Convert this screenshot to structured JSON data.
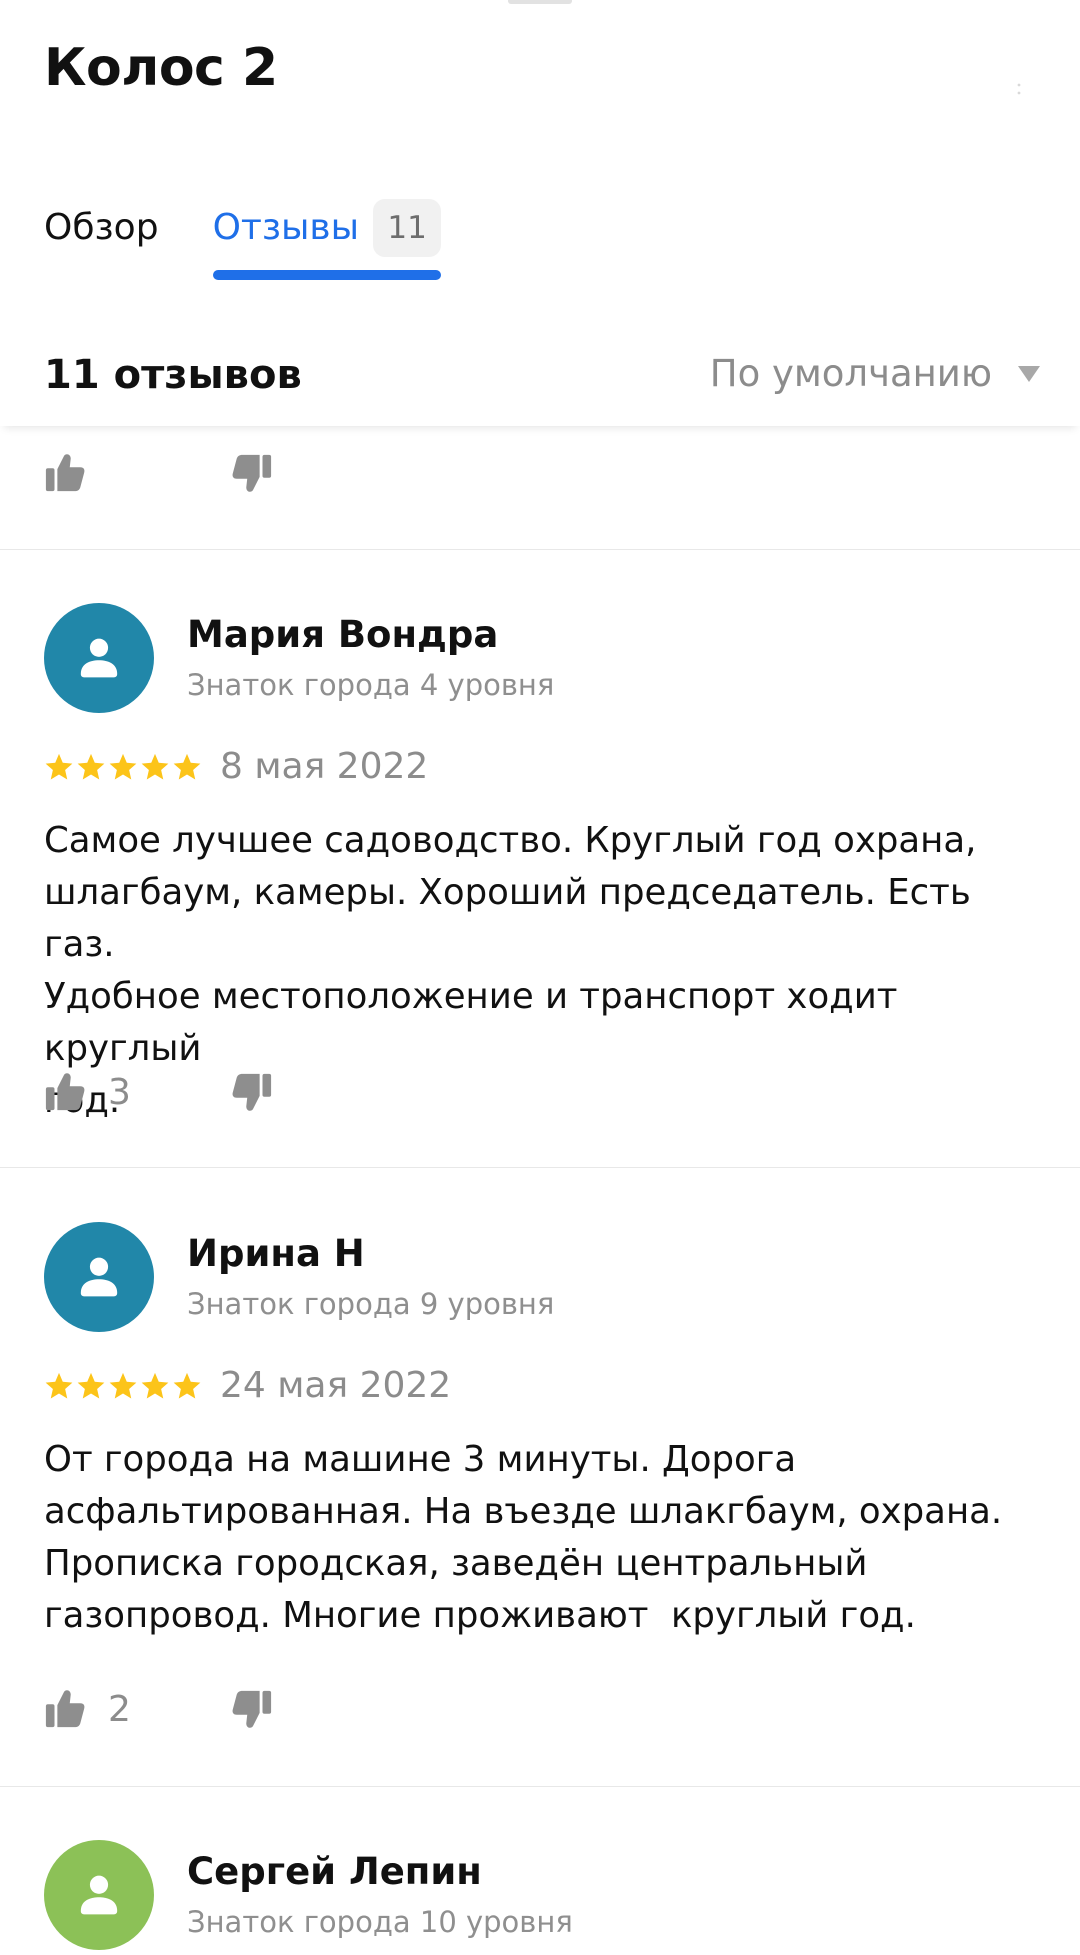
{
  "header": {
    "title": "Колос 2"
  },
  "tabs": [
    {
      "label": "Обзор"
    },
    {
      "label": "Отзывы",
      "count": "11"
    }
  ],
  "sort_bar": {
    "reviews_count": "11 отзывов",
    "sort_label": "По умолчанию"
  },
  "colors": {
    "accent": "#1f6fe8",
    "star": "#fcc419",
    "avatar_blue": "#2187a9",
    "avatar_green": "#8cc157"
  },
  "reviews": [
    {
      "author": "Мария Вондра",
      "level": "Знаток города 4 уровня",
      "avatar_color": "#2187a9",
      "rating": 5,
      "date": "8 мая 2022",
      "text": "Самое лучшее садоводство. Круглый год охрана,\nшлагбаум, камеры. Хороший председатель. Есть газ.\nУдобное местоположение и транспорт ходит круглый\nгод.",
      "likes": "3"
    },
    {
      "author": "Ирина Н",
      "level": "Знаток города 9 уровня",
      "avatar_color": "#2187a9",
      "rating": 5,
      "date": "24 мая 2022",
      "text": "От города на машине 3 минуты. Дорога\nасфальтированная. На въезде шлакгбаум, охрана.\nПрописка городская, заведён центральный\nгазопровод. Многие проживают  круглый год.",
      "likes": "2"
    },
    {
      "author": "Сергей Лепин",
      "level": "Знаток города 10 уровня",
      "avatar_color": "#8cc157"
    }
  ]
}
